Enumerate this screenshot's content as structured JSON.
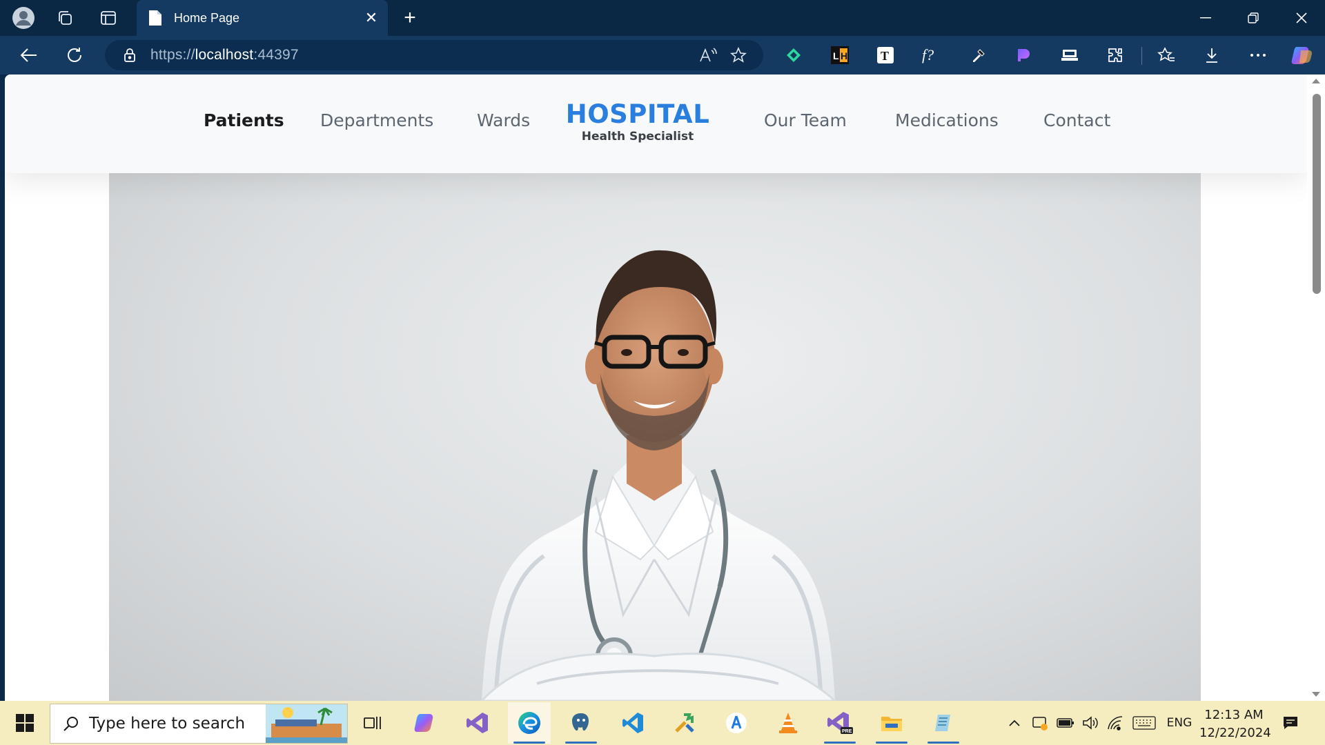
{
  "browser": {
    "tab_title": "Home Page",
    "url_scheme": "https://",
    "url_host": "localhost",
    "url_port": ":44397",
    "extensions": [
      "fluent-ext-icon",
      "lh-ext-icon",
      "t-ext-icon",
      "f-question-ext-icon",
      "eyedropper-ext-icon",
      "gradient-ext-icon",
      "cast-ext-icon"
    ]
  },
  "site": {
    "nav": {
      "patients": "Patients",
      "departments": "Departments",
      "wards": "Wards",
      "our_team": "Our Team",
      "medications": "Medications",
      "contact": "Contact"
    },
    "brand_title": "HOSPITAL",
    "brand_subtitle": "Health Specialist",
    "accent_color": "#2a7fde"
  },
  "taskbar": {
    "search_placeholder": "Type here to search",
    "time": "12:13 AM",
    "date": "12/22/2024",
    "language": "ENG"
  }
}
